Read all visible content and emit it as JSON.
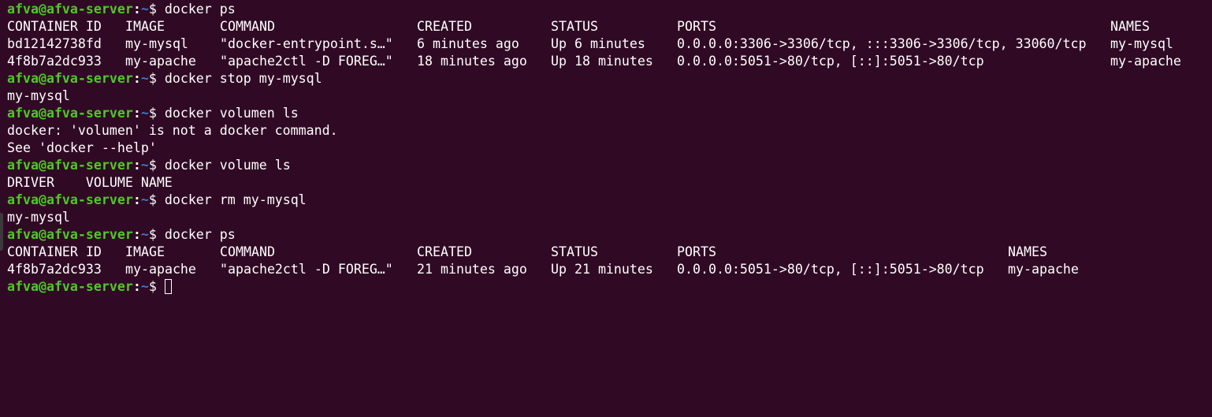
{
  "prompt": {
    "user": "afva@afva-server",
    "sep": ":",
    "path": "~",
    "sign": "$ "
  },
  "commands": {
    "c1": "docker ps",
    "c2": "docker stop my-mysql",
    "c3": "docker volumen ls",
    "c4": "docker volume ls",
    "c5": "docker rm my-mysql",
    "c6": "docker ps"
  },
  "ps1": {
    "headers": {
      "container_id": "CONTAINER ID",
      "image": "IMAGE",
      "command": "COMMAND",
      "created": "CREATED",
      "status": "STATUS",
      "ports": "PORTS",
      "names": "NAMES"
    },
    "rows": [
      {
        "container_id": "bd12142738fd",
        "image": "my-mysql",
        "command": "\"docker-entrypoint.s…\"",
        "created": "6 minutes ago",
        "status": "Up 6 minutes",
        "ports": "0.0.0.0:3306->3306/tcp, :::3306->3306/tcp, 33060/tcp",
        "names": "my-mysql"
      },
      {
        "container_id": "4f8b7a2dc933",
        "image": "my-apache",
        "command": "\"apache2ctl -D FOREG…\"",
        "created": "18 minutes ago",
        "status": "Up 18 minutes",
        "ports": "0.0.0.0:5051->80/tcp, [::]:5051->80/tcp",
        "names": "my-apache"
      }
    ]
  },
  "outputs": {
    "stop_result": "my-mysql",
    "volumen_error": "docker: 'volumen' is not a docker command.",
    "volumen_help": "See 'docker --help'",
    "volume_header": "DRIVER    VOLUME NAME",
    "rm_result": "my-mysql"
  },
  "ps2": {
    "headers": {
      "container_id": "CONTAINER ID",
      "image": "IMAGE",
      "command": "COMMAND",
      "created": "CREATED",
      "status": "STATUS",
      "ports": "PORTS",
      "names": "NAMES"
    },
    "rows": [
      {
        "container_id": "4f8b7a2dc933",
        "image": "my-apache",
        "command": "\"apache2ctl -D FOREG…\"",
        "created": "21 minutes ago",
        "status": "Up 21 minutes",
        "ports": "0.0.0.0:5051->80/tcp, [::]:5051->80/tcp",
        "names": "my-apache"
      }
    ]
  },
  "colors": {
    "background": "#300a24",
    "prompt_user": "#4ec926",
    "prompt_path": "#3b78c9",
    "text": "#ffffff"
  }
}
